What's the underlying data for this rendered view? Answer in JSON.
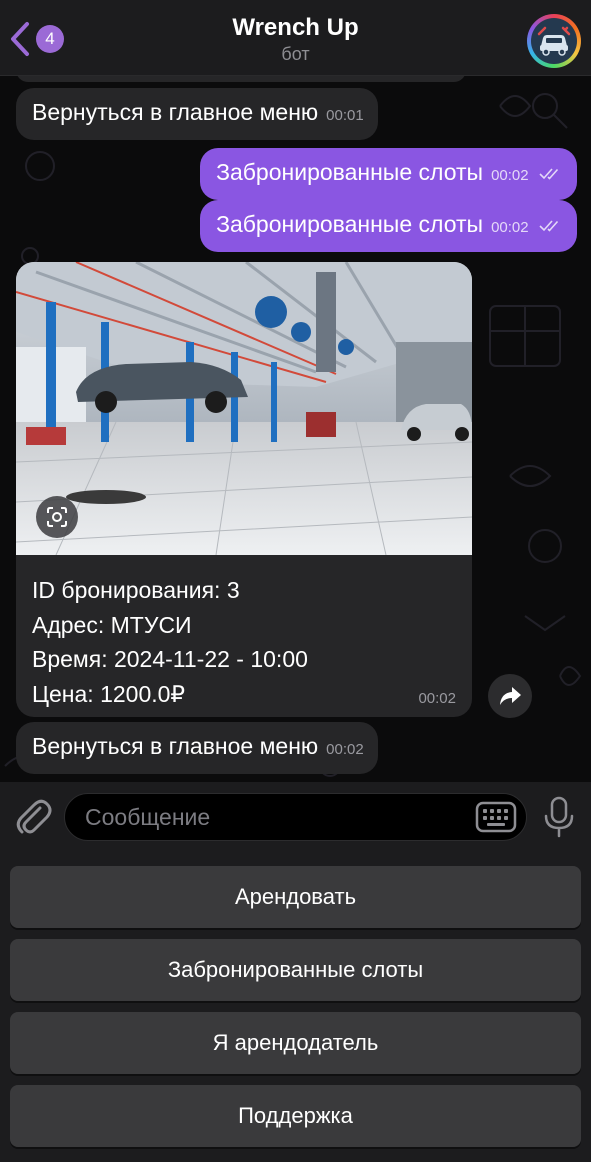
{
  "header": {
    "back_count": "4",
    "title": "Wrench Up",
    "subtitle": "бот"
  },
  "messages": [
    {
      "text": "Вернуться в главное меню",
      "time": "00:01",
      "direction": "incoming"
    },
    {
      "text": "Забронированные слоты",
      "time": "00:02",
      "direction": "outgoing"
    },
    {
      "text": "Забронированные слоты",
      "time": "00:02",
      "direction": "outgoing"
    },
    {
      "lines": [
        "ID бронирования: 3",
        "Адрес: МТУСИ",
        "Время: 2024-11-22 - 10:00",
        "Цена: 1200.0₽"
      ],
      "time": "00:02",
      "direction": "incoming",
      "has_photo": true
    },
    {
      "text": "Вернуться в главное меню",
      "time": "00:02",
      "direction": "incoming"
    }
  ],
  "input": {
    "placeholder": "Сообщение"
  },
  "keyboard": {
    "buttons": [
      "Арендовать",
      "Забронированные слоты",
      "Я арендодатель",
      "Поддержка"
    ]
  },
  "colors": {
    "accent": "#8a56e2",
    "incoming_bubble": "#262628",
    "header_bg": "#1c1c1e",
    "keyboard_button": "#3a3a3c"
  },
  "icons": [
    "back-chevron-icon",
    "car-repair-avatar-icon",
    "scan-icon",
    "share-icon",
    "attach-icon",
    "keyboard-icon",
    "microphone-icon",
    "double-check-icon"
  ]
}
